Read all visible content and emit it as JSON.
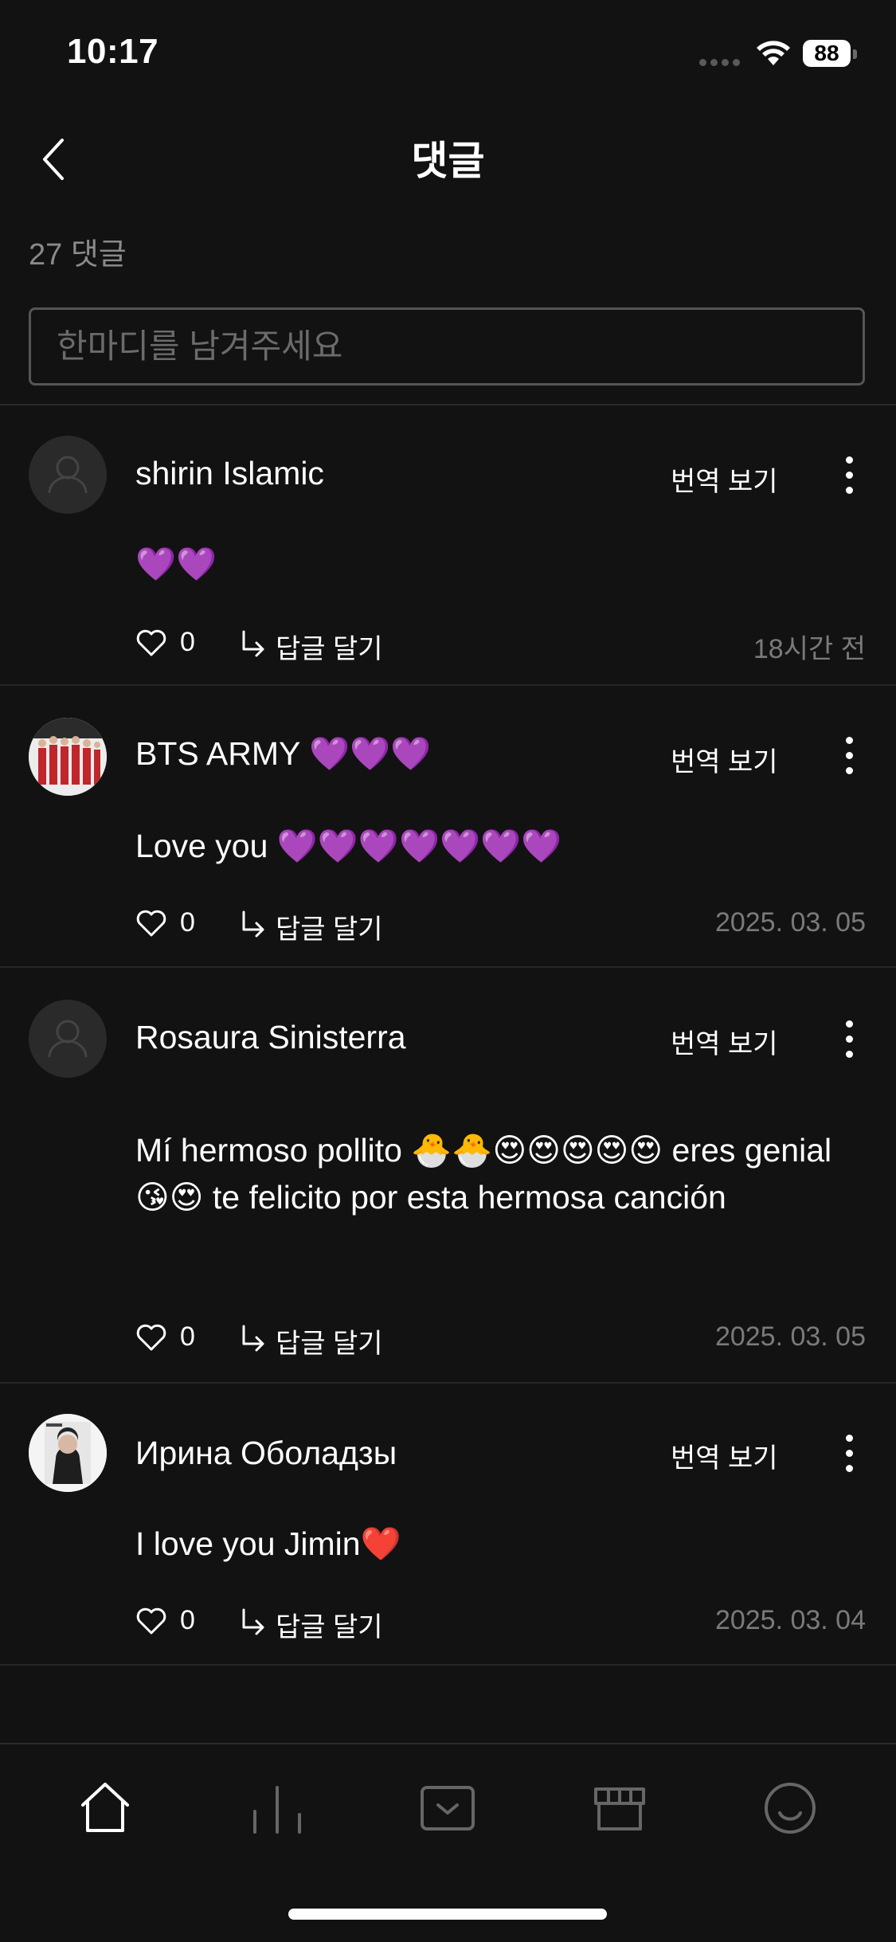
{
  "status_bar": {
    "time": "10:17",
    "battery": "88"
  },
  "header": {
    "title": "댓글",
    "back_icon": "chevron-left-icon"
  },
  "comment_count_label": "27 댓글",
  "comment_input": {
    "placeholder": "한마디를 남겨주세요",
    "value": ""
  },
  "comments": [
    {
      "author": "shirin Islamic",
      "avatar": "default-avatar",
      "translate_label": "번역 보기",
      "text": "💜💜",
      "likes": "0",
      "reply_label": "답글 달기",
      "time": "18시간 전"
    },
    {
      "author": "BTS ARMY 💜💜💜",
      "avatar": "group-photo-avatar",
      "translate_label": "번역 보기",
      "text": "Love you 💜💜💜💜💜💜💜",
      "likes": "0",
      "reply_label": "답글 달기",
      "time": "2025. 03. 05"
    },
    {
      "author": "Rosaura Sinisterra",
      "avatar": "default-avatar",
      "translate_label": "번역 보기",
      "text": "Mí hermoso pollito 🐣🐣😍😍😍😍😍 eres genial 😘😍 te felicito por esta hermosa canción",
      "likes": "0",
      "reply_label": "답글 달기",
      "time": "2025. 03. 05"
    },
    {
      "author": "Ирина Оболадзы",
      "avatar": "magazine-photo-avatar",
      "translate_label": "번역 보기",
      "text": "I love you Jimin❤️",
      "likes": "0",
      "reply_label": "답글 달기",
      "time": "2025. 03. 04"
    }
  ],
  "bottom_nav": {
    "items": [
      "home-icon",
      "chart-icon",
      "inbox-icon",
      "store-icon",
      "profile-smile-icon"
    ],
    "active": "home-icon"
  },
  "colors": {
    "background": "#121212",
    "text": "#ffffff",
    "muted": "#7a7a7a",
    "divider": "#262626"
  }
}
